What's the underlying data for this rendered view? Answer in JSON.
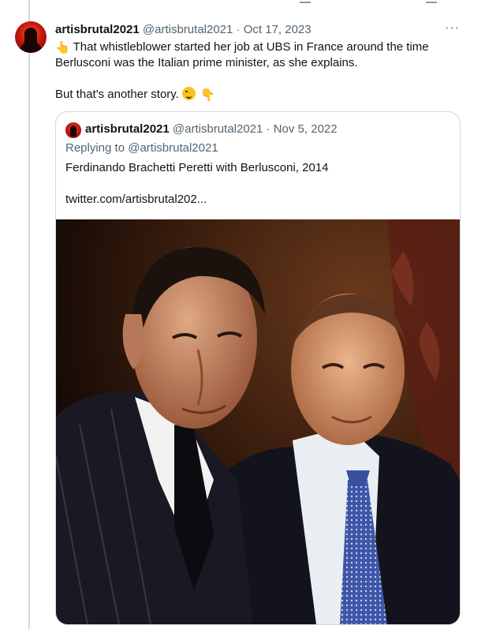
{
  "tweet": {
    "author_name": "artisbrutal2021",
    "author_handle": "@artisbrutal2021",
    "separator": "·",
    "date": "Oct 17, 2023",
    "more": "···",
    "emoji_point_up": "👆",
    "text_line1": "That whistleblower started her job at UBS in France around the time Berlusconi was the Italian prime minister, as she explains.",
    "text_line2": "But that's another story.",
    "emoji_point_down": "👇"
  },
  "quote": {
    "author_name": "artisbrutal2021",
    "author_handle": "@artisbrutal2021",
    "separator": "·",
    "date": "Nov 5, 2022",
    "replying_label": "Replying to",
    "replying_handle": "@artisbrutal2021",
    "text": "Ferdinando Brachetti Peretti with Berlusconi, 2014",
    "link": "twitter.com/artisbrutal202..."
  }
}
